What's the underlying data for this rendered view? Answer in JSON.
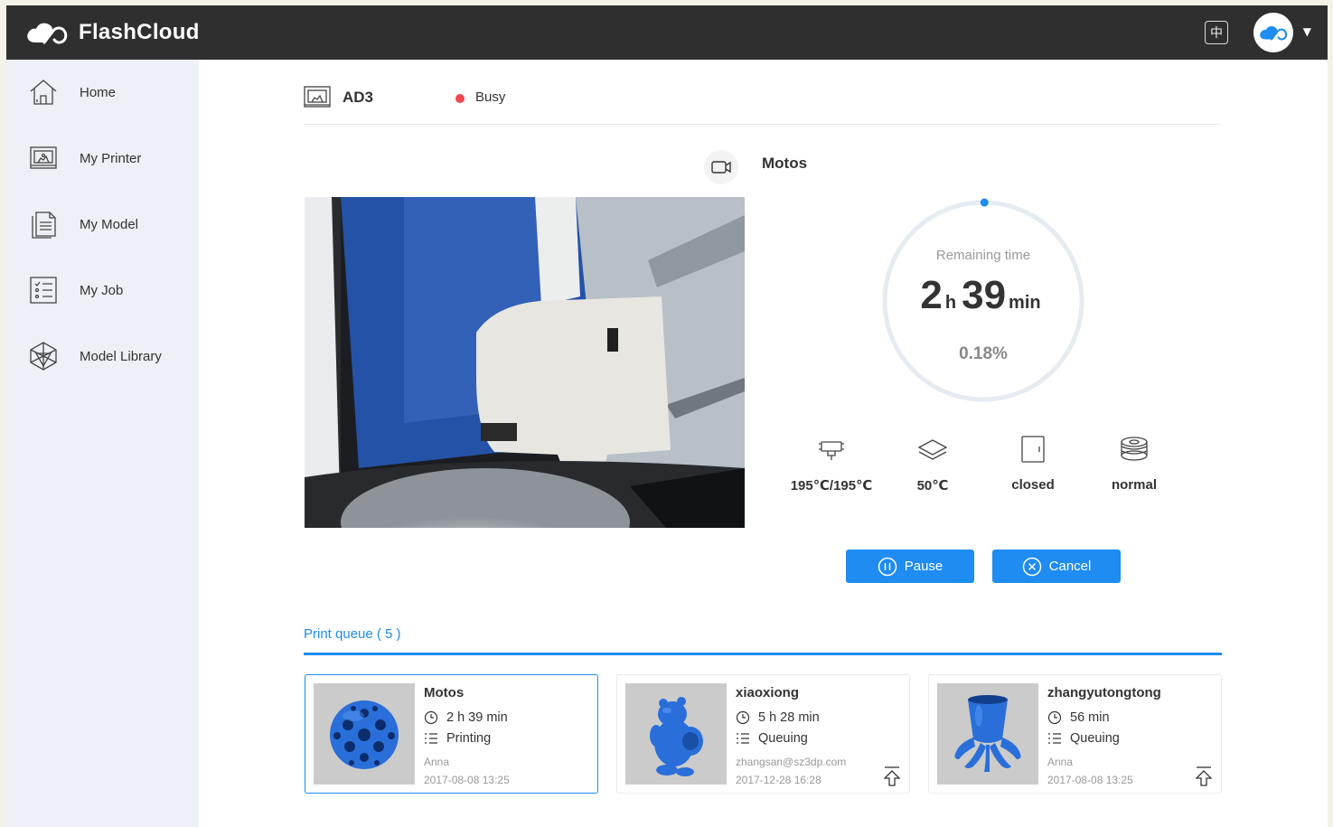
{
  "app": {
    "name": "FlashCloud"
  },
  "header": {
    "lang_label": "中"
  },
  "sidebar": {
    "items": [
      {
        "label": "Home",
        "icon": "home-icon"
      },
      {
        "label": "My Printer",
        "icon": "printer-icon"
      },
      {
        "label": "My Model",
        "icon": "document-icon"
      },
      {
        "label": "My Job",
        "icon": "job-list-icon"
      },
      {
        "label": "Model Library",
        "icon": "polyhedron-icon"
      }
    ]
  },
  "printer": {
    "name": "AD3",
    "status": "Busy",
    "status_color": "#f0484e"
  },
  "job": {
    "name": "Motos",
    "remaining_label": "Remaining time",
    "hours": "2",
    "hours_unit": "h",
    "minutes": "39",
    "minutes_unit": "min",
    "progress_text": "0.18%",
    "progress_fraction": 0.0018
  },
  "stats": {
    "extruder": "195℃/195℃",
    "bed": "50℃",
    "door": "closed",
    "filament": "normal"
  },
  "actions": {
    "pause_label": "Pause",
    "cancel_label": "Cancel"
  },
  "queue": {
    "title": "Print queue ( 5 )",
    "items": [
      {
        "name": "Motos",
        "time": "2 h 39 min",
        "state": "Printing",
        "owner": "Anna",
        "date": "2017-08-08 13:25"
      },
      {
        "name": "xiaoxiong",
        "time": "5 h 28 min",
        "state": "Queuing",
        "owner": "zhangsan@sz3dp.com",
        "date": "2017-12-28 16:28"
      },
      {
        "name": "zhangyutongtong",
        "time": "56 min",
        "state": "Queuing",
        "owner": "Anna",
        "date": "2017-08-08 13:25"
      }
    ]
  },
  "colors": {
    "accent": "#1e8cf0",
    "header_bg": "#2f2f2f",
    "sidebar_bg": "#edf0f6"
  }
}
